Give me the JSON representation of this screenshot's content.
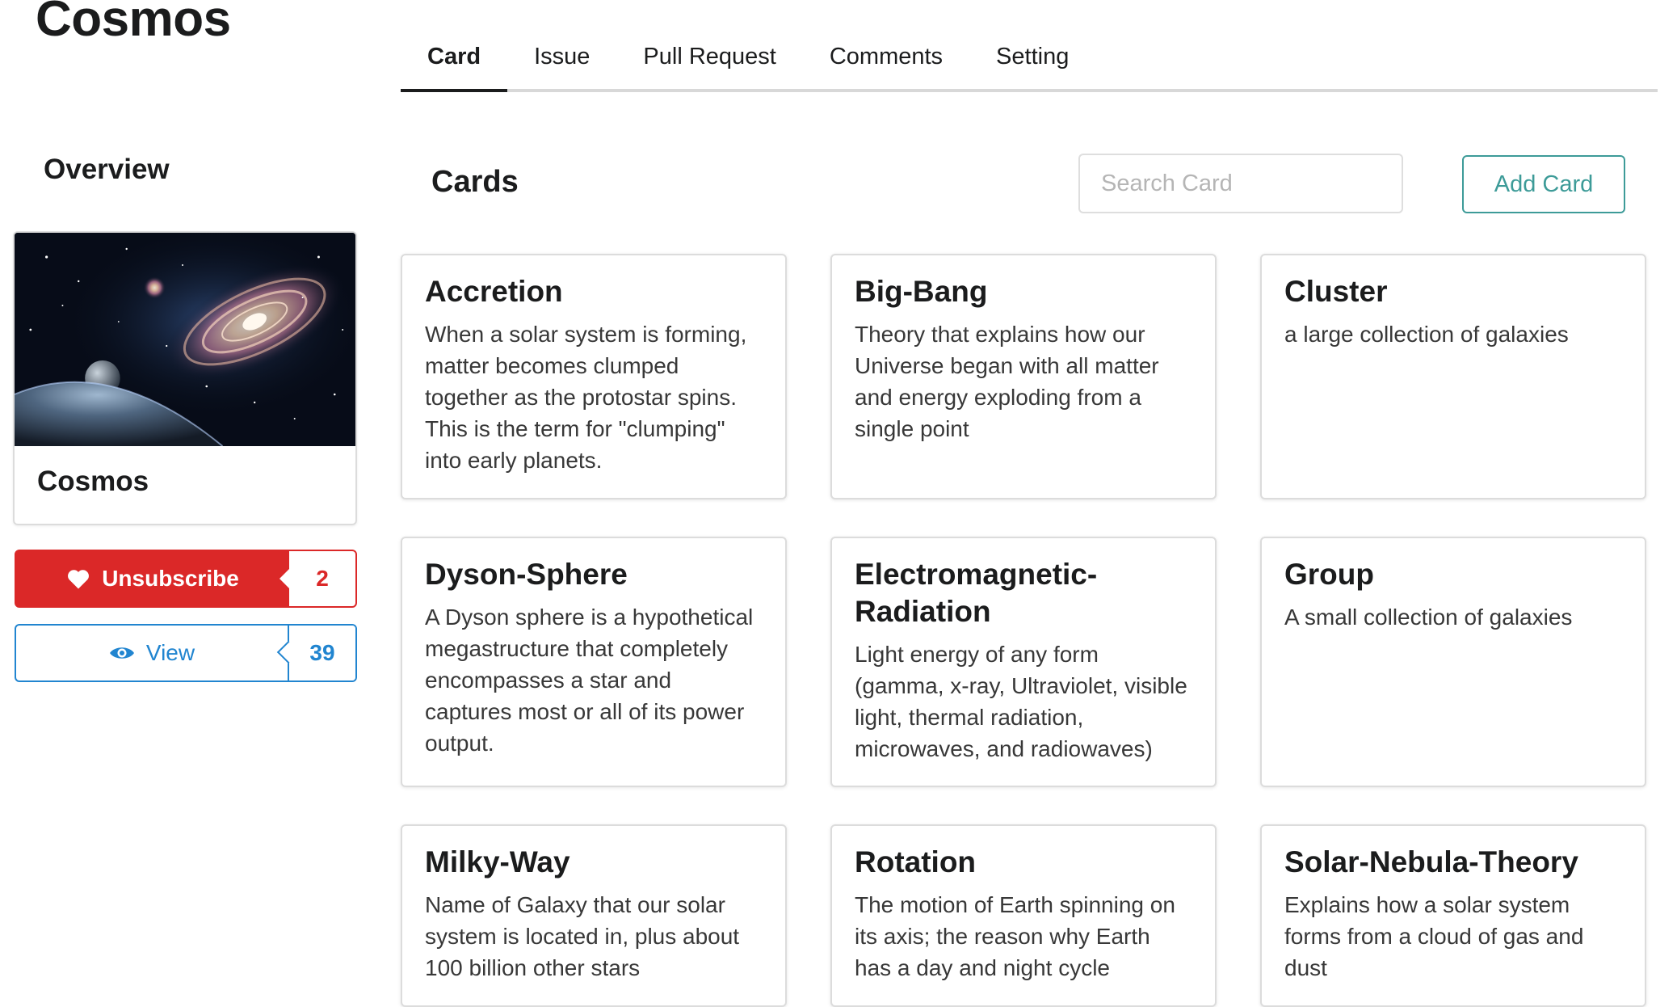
{
  "app": {
    "title": "Cosmos"
  },
  "tabs": [
    {
      "label": "Card",
      "active": true
    },
    {
      "label": "Issue",
      "active": false
    },
    {
      "label": "Pull Request",
      "active": false
    },
    {
      "label": "Comments",
      "active": false
    },
    {
      "label": "Setting",
      "active": false
    }
  ],
  "sidebar": {
    "heading": "Overview",
    "profile": {
      "name": "Cosmos",
      "image": "galaxy-image"
    },
    "unsubscribe": {
      "label": "Unsubscribe",
      "count": "2",
      "icon": "heart-icon",
      "color": "#db2828"
    },
    "view": {
      "label": "View",
      "count": "39",
      "icon": "eye-icon",
      "color": "#2185d0"
    }
  },
  "main": {
    "heading": "Cards",
    "search": {
      "placeholder": "Search Card",
      "value": "",
      "icon": "search-icon"
    },
    "add_button": {
      "label": "Add Card",
      "color": "#3d9b98"
    },
    "cards": [
      {
        "title": "Accretion",
        "description": "When a solar system is forming, matter becomes clumped together as the protostar spins. This is the term for \"clumping\" into early planets."
      },
      {
        "title": "Big-Bang",
        "description": "Theory that explains how our Universe began with all matter and energy exploding from a single point"
      },
      {
        "title": "Cluster",
        "description": "a large collection of galaxies"
      },
      {
        "title": "Dyson-Sphere",
        "description": "A Dyson sphere is a hypothetical megastructure that completely encompasses a star and captures most or all of its power output."
      },
      {
        "title": "Electromagnetic-Radiation",
        "description": "Light energy of any form (gamma, x-ray, Ultraviolet, visible light, thermal radiation, microwaves, and radiowaves)"
      },
      {
        "title": "Group",
        "description": "A small collection of galaxies"
      },
      {
        "title": "Milky-Way",
        "description": "Name of Galaxy that our solar system is located in, plus about 100 billion other stars"
      },
      {
        "title": "Rotation",
        "description": "The motion of Earth spinning on its axis; the reason why Earth has a day and night cycle"
      },
      {
        "title": "Solar-Nebula-Theory",
        "description": "Explains how a solar system forms from a cloud of gas and dust"
      }
    ]
  }
}
